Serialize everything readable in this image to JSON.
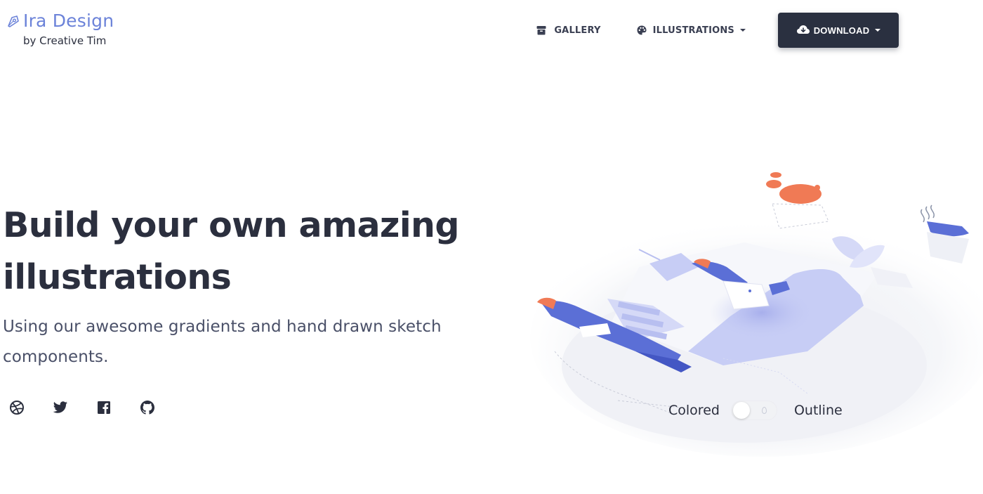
{
  "brand": {
    "title": "Ira Design",
    "subtitle": "by Creative Tim",
    "icon": "pen-nib-icon",
    "color": "#6c83d9"
  },
  "nav": {
    "gallery": {
      "label": "GALLERY",
      "icon": "box-icon"
    },
    "illustrations": {
      "label": "ILLUSTRATIONS",
      "icon": "palette-icon"
    },
    "download": {
      "label": "DOWNLOAD",
      "icon": "cloud-download-icon",
      "bg": "#2a3040"
    }
  },
  "hero": {
    "title": "Build your own amazing illustrations",
    "subtitle": "Using our awesome gradients and hand drawn sketch components."
  },
  "social": [
    "dribbble-icon",
    "twitter-icon",
    "facebook-icon",
    "github-icon"
  ],
  "illustration_toggle": {
    "left_label": "Colored",
    "right_label": "Outline",
    "state": "colored"
  },
  "colors": {
    "text": "#2b2f3e",
    "accent_blue": "#5b6fd6",
    "accent_orange": "#f07a55",
    "light_lavender": "#c7cdf5"
  }
}
